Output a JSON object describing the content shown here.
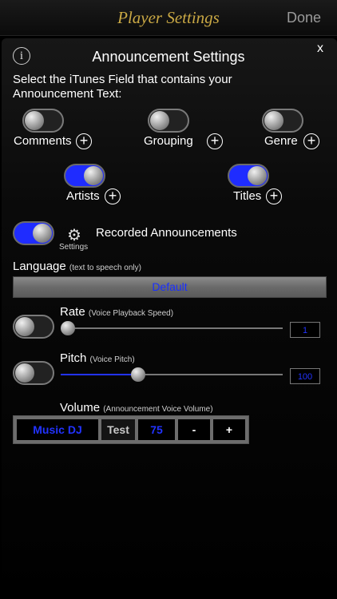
{
  "navbar": {
    "title": "Player Settings",
    "done_label": "Done"
  },
  "panel": {
    "title": "Announcement Settings",
    "close_label": "x",
    "info_label": "i",
    "instruction_line1": "Select the iTunes Field that contains your",
    "instruction_line2": "Announcement Text:"
  },
  "fields": [
    {
      "label": "Comments",
      "on": false
    },
    {
      "label": "Grouping",
      "on": false
    },
    {
      "label": "Genre",
      "on": false
    },
    {
      "label": "Artists",
      "on": true
    },
    {
      "label": "Titles",
      "on": true
    }
  ],
  "recorded": {
    "label": "Recorded Announcements",
    "settings_label": "Settings",
    "on": true
  },
  "language": {
    "label": "Language",
    "hint": "(text to speech only)",
    "value": "Default"
  },
  "rate": {
    "label": "Rate",
    "hint": "(Voice Playback Speed)",
    "value": "1",
    "on": false,
    "level": 0.0
  },
  "pitch": {
    "label": "Pitch",
    "hint": "(Voice Pitch)",
    "value": "100",
    "on": false,
    "level": 0.34
  },
  "volume": {
    "label": "Volume",
    "hint": "(Announcement Voice Volume)",
    "voice": "Music DJ",
    "test_label": "Test",
    "value": "75",
    "minus_label": "-",
    "plus_label": "+"
  },
  "colors": {
    "accent_blue": "#1f2cff",
    "title_gold": "#c9a844"
  },
  "icons": {
    "plus": "plus-circle-icon",
    "gear": "gear-icon",
    "info": "info-icon",
    "close": "close-icon"
  }
}
